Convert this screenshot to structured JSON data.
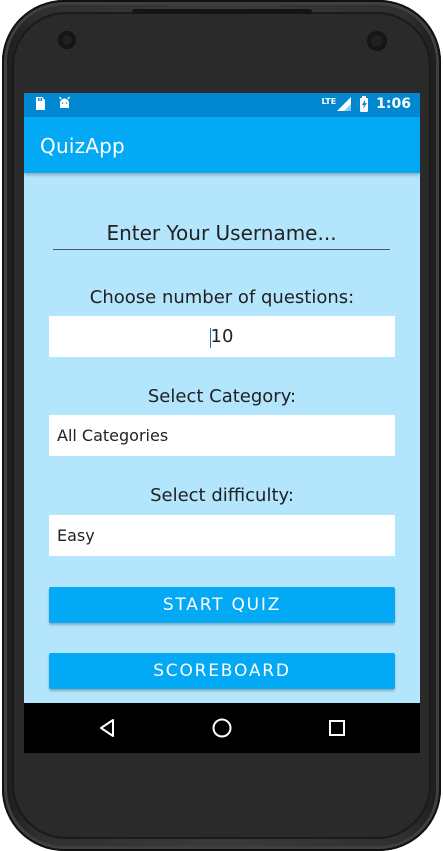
{
  "status_bar": {
    "time": "1:06",
    "network": "LTE",
    "left_icons": [
      "sd-card-icon",
      "android-icon"
    ],
    "right_icons": [
      "signal-icon",
      "battery-icon"
    ]
  },
  "app": {
    "title": "QuizApp"
  },
  "form": {
    "username": {
      "placeholder": "Enter Your Username...",
      "value": ""
    },
    "questions": {
      "label": "Choose number of questions:",
      "value": "10"
    },
    "category": {
      "label": "Select Category:",
      "selected": "All Categories"
    },
    "difficulty": {
      "label": "Select difficulty:",
      "selected": "Easy"
    }
  },
  "buttons": {
    "start": "START QUIZ",
    "scoreboard": "SCOREBOARD"
  },
  "navigation": {
    "icons": [
      "back-icon",
      "home-icon",
      "recent-apps-icon"
    ]
  },
  "colors": {
    "status_bar": "#0288D1",
    "app_bar": "#03A9F4",
    "background": "#B3E5FC",
    "button": "#03A9F4",
    "nav_bar": "#000000"
  }
}
